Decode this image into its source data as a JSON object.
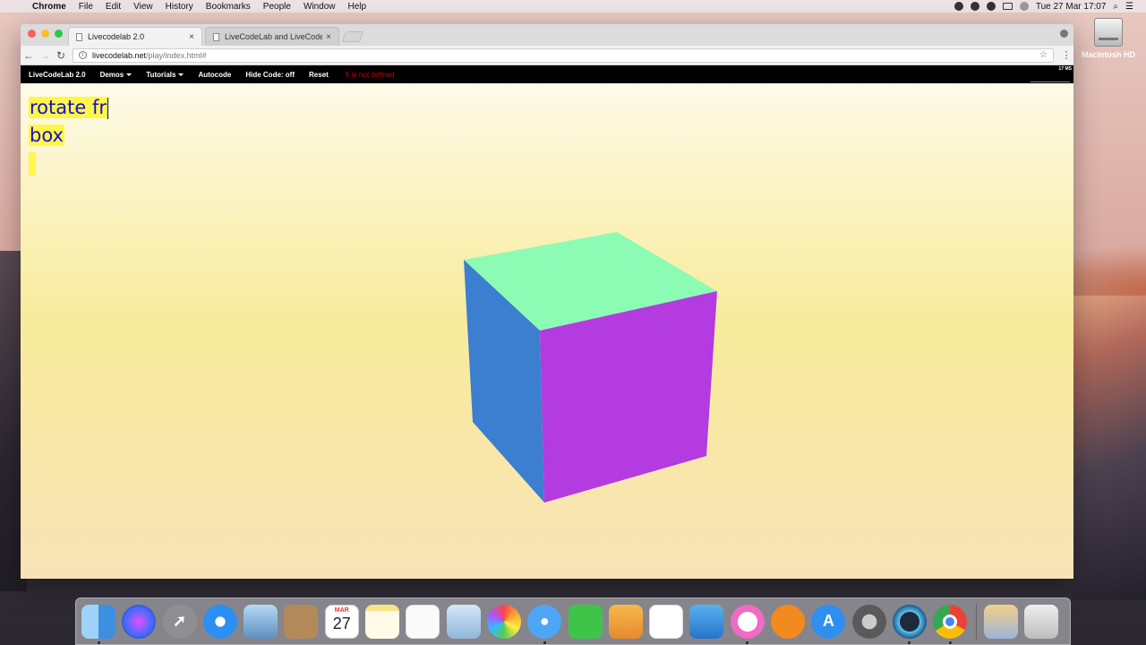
{
  "menubar": {
    "app_name": "Chrome",
    "items": [
      "File",
      "Edit",
      "View",
      "History",
      "Bookmarks",
      "People",
      "Window",
      "Help"
    ],
    "clock": "Tue 27 Mar  17:07"
  },
  "desktop": {
    "hd_label": "Macintosh HD"
  },
  "browser": {
    "tabs": [
      {
        "title": "Livecodelab 2.0",
        "active": true
      },
      {
        "title": "LiveCodeLab and LiveCodeLab",
        "active": false
      }
    ],
    "url_host": "livecodelab.net",
    "url_path": "/play/index.html#"
  },
  "livecodelab": {
    "nav": {
      "brand": "LiveCodeLab 2.0",
      "demos": "Demos",
      "tutorials": "Tutorials",
      "autocode": "Autocode",
      "hide_code": "Hide Code: off",
      "reset": "Reset",
      "error": "fr is not defined"
    },
    "fps": "17 MS",
    "code": {
      "line1": "rotate fr",
      "line2": "box"
    },
    "cube_colors": {
      "top": "#8cfcb5",
      "left": "#3c7ed0",
      "front": "#b33be0"
    }
  },
  "dock": {
    "apps": [
      "finder-icon",
      "siri-icon",
      "launchpad-icon",
      "safari-icon",
      "mail-icon",
      "contacts-icon",
      "calendar-icon",
      "notes-icon",
      "reminders-icon",
      "preview-icon",
      "photos-icon",
      "messages-icon",
      "facetime-icon",
      "pages-icon",
      "numbers-icon",
      "keynote-icon",
      "itunes-icon",
      "ibooks-icon",
      "app-store-icon",
      "system-preferences-icon",
      "quicktime-icon",
      "chrome-icon"
    ],
    "calendar": {
      "month": "MAR",
      "day": "27"
    }
  }
}
